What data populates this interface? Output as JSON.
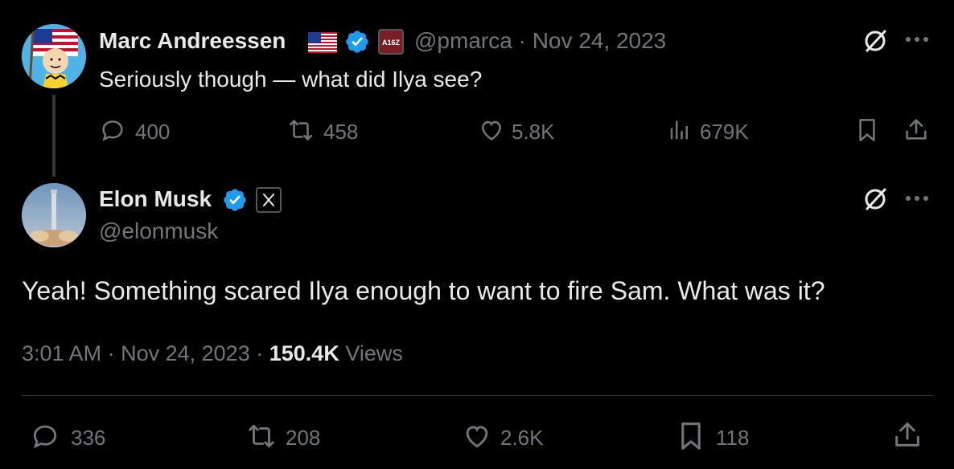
{
  "parent_tweet": {
    "author_name": "Marc Andreessen",
    "handle": "@pmarca",
    "separator": "·",
    "date": "Nov 24, 2023",
    "text": "Seriously though — what did Ilya see?",
    "stats": {
      "replies": "400",
      "reposts": "458",
      "likes": "5.8K",
      "views": "679K"
    }
  },
  "main_tweet": {
    "author_name": "Elon Musk",
    "handle": "@elonmusk",
    "text": "Yeah! Something scared Ilya enough to want to fire Sam. What was it?",
    "time": "3:01 AM",
    "separator": "·",
    "date": "Nov 24, 2023",
    "separator2": "·",
    "views_count": "150.4K",
    "views_label": "Views",
    "stats": {
      "replies": "336",
      "reposts": "208",
      "likes": "2.6K",
      "bookmarks": "118"
    }
  },
  "colors": {
    "background": "#000000",
    "text_primary": "#e7e9ea",
    "text_secondary": "#71767b",
    "verified": "#1d9bf0"
  },
  "icons": [
    "grok-icon",
    "more-icon",
    "reply-icon",
    "repost-icon",
    "like-icon",
    "views-icon",
    "bookmark-icon",
    "share-icon",
    "verified-badge-icon",
    "us-flag-icon",
    "a16z-logo-icon",
    "x-logo-icon"
  ]
}
